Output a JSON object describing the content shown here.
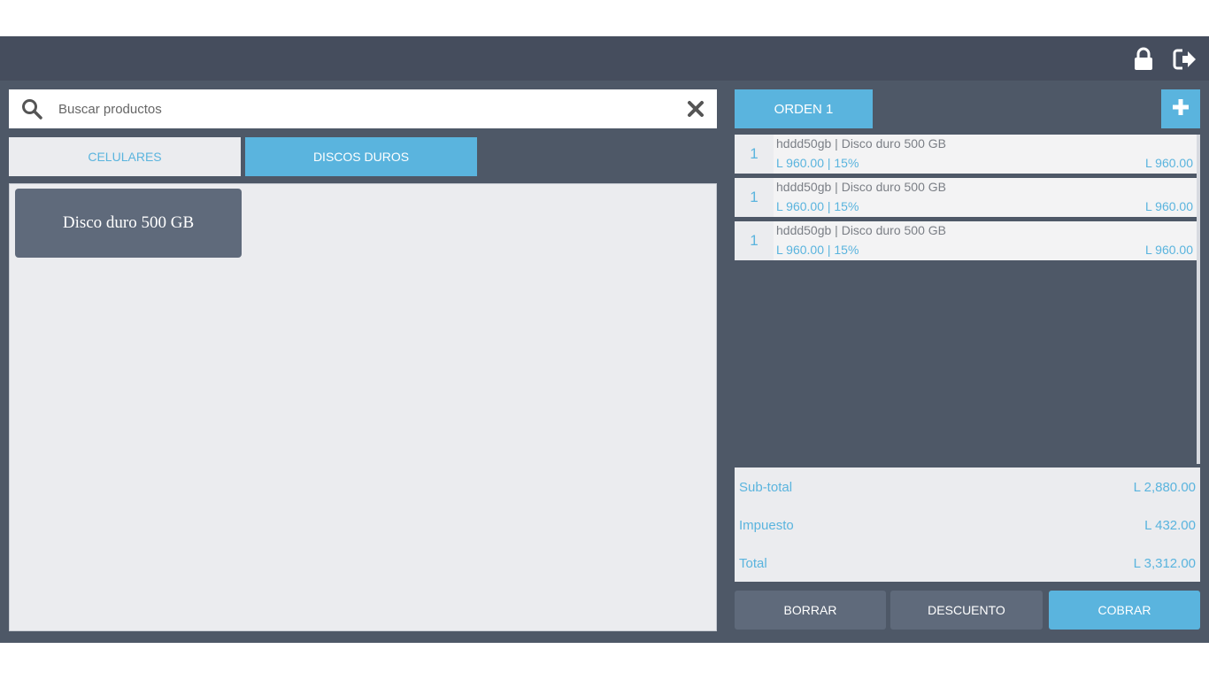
{
  "colors": {
    "accent": "#5ab4de",
    "panel": "#4e5867",
    "topbar": "#454d5d",
    "button_dark": "#5f6a7b",
    "surface": "#ebecef"
  },
  "topbar": {
    "icons": [
      "lock-icon",
      "logout-icon"
    ]
  },
  "search": {
    "placeholder": "Buscar productos",
    "value": ""
  },
  "categories": [
    {
      "label": "CELULARES",
      "selected": false
    },
    {
      "label": "DISCOS DUROS",
      "selected": true
    }
  ],
  "products": [
    {
      "name": "Disco duro 500 GB"
    }
  ],
  "orders": {
    "tabs": [
      {
        "label": "ORDEN 1"
      }
    ],
    "items": [
      {
        "qty": "1",
        "desc": "hddd50gb | Disco duro 500 GB",
        "price": "L 960.00 | 15%",
        "total": "L 960.00"
      },
      {
        "qty": "1",
        "desc": "hddd50gb | Disco duro 500 GB",
        "price": "L 960.00 | 15%",
        "total": "L 960.00"
      },
      {
        "qty": "1",
        "desc": "hddd50gb | Disco duro 500 GB",
        "price": "L 960.00 | 15%",
        "total": "L 960.00"
      }
    ]
  },
  "totals": {
    "subtotal_label": "Sub-total",
    "subtotal_value": "L 2,880.00",
    "tax_label": "Impuesto",
    "tax_value": "L 432.00",
    "total_label": "Total",
    "total_value": "L 3,312.00"
  },
  "actions": {
    "clear_label": "BORRAR",
    "discount_label": "DESCUENTO",
    "charge_label": "COBRAR"
  }
}
